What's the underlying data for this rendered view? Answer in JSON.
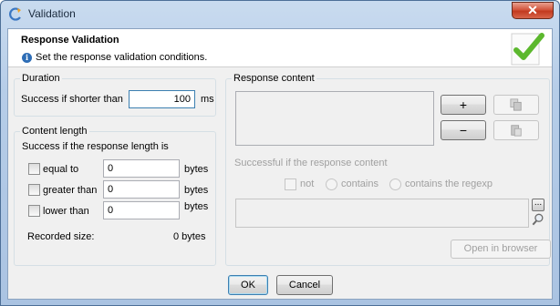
{
  "window": {
    "title": "Validation"
  },
  "header": {
    "title": "Response Validation",
    "description": "Set the response validation conditions."
  },
  "duration": {
    "group_title": "Duration",
    "label": "Success if shorter than",
    "value": "100",
    "unit": "ms"
  },
  "content_length": {
    "group_title": "Content length",
    "subtitle": "Success if the response length is",
    "rows": [
      {
        "label": "equal to",
        "value": "0",
        "unit": "bytes"
      },
      {
        "label": "greater than",
        "value": "0",
        "unit": "bytes"
      },
      {
        "label": "lower than",
        "value": "0",
        "unit": "bytes"
      }
    ],
    "recorded_label": "Recorded size:",
    "recorded_value": "0 bytes"
  },
  "response_content": {
    "group_title": "Response content",
    "add_label": "+",
    "remove_label": "−",
    "success_label": "Successful if the response content",
    "not_label": "not",
    "contains_label": "contains",
    "regexp_label": "contains the regexp",
    "more_label": "...",
    "open_browser_label": "Open in browser"
  },
  "footer": {
    "ok_label": "OK",
    "cancel_label": "Cancel"
  },
  "icons": {
    "app": "refresh-arc-icon",
    "info": "info-icon",
    "header_check": "checkmark-icon",
    "copy": "copy-icon",
    "paste": "paste-icon",
    "search": "magnifier-icon"
  },
  "colors": {
    "title_bar": "#b6cde8",
    "close_button": "#c23a1f",
    "check_green": "#5cb82e",
    "dialog_bg": "#f0f0f0",
    "disabled_text": "#a0a0a0"
  }
}
